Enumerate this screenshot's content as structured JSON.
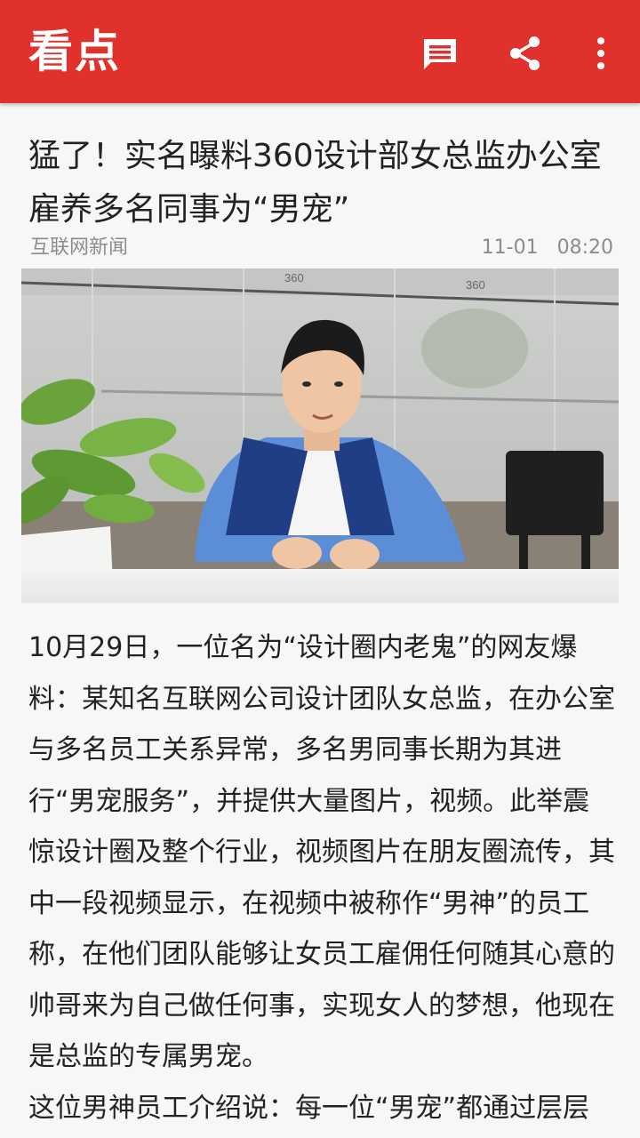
{
  "app": {
    "title": "看点"
  },
  "toolbar": {
    "icons": [
      "comment-icon",
      "share-icon",
      "more-vert-icon"
    ]
  },
  "article": {
    "title": "猛了！实名曝料360设计部女总监办公室雇养多名同事为“男宠”",
    "source": "互联网新闻",
    "date": "11-01",
    "time": "08:20",
    "paragraphs": [
      "10月29日，一位名为“设计圈内老鬼”的网友爆料：某知名互联网公司设计团队女总监，在办公室与多名员工关系异常，多名男同事长期为其进行“男宠服务”，并提供大量图片，视频。此举震惊设计圈及整个行业，视频图片在朋友圈流传，其中一段视频显示，在视频中被称作“男神”的员工称，在他们团队能够让女员工雇佣任何随其心意的帅哥来为自己做任何事，实现女人的梦想，他现在是总监的专属男宠。",
      "这位男神员工介绍说：每一位“男宠”都通过层层筛选，相貌堂堂，风度翩翩，身材出众，“男"
    ]
  },
  "photo": {
    "wall_logo": "360"
  },
  "colors": {
    "brand_red": "#e0312c",
    "text_main": "#222222",
    "text_meta": "#8c8c8c"
  }
}
